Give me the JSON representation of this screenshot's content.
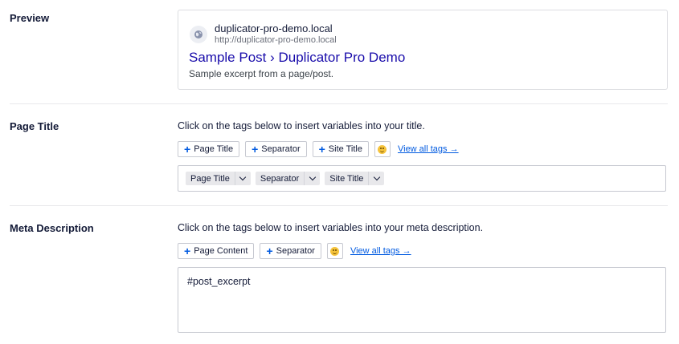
{
  "preview": {
    "label": "Preview",
    "icon": "globe-icon",
    "site_name": "duplicator-pro-demo.local",
    "site_url": "http://duplicator-pro-demo.local",
    "title": "Sample Post › Duplicator Pro Demo",
    "excerpt": "Sample excerpt from a page/post."
  },
  "page_title": {
    "label": "Page Title",
    "instruction": "Click on the tags below to insert variables into your title.",
    "tag_buttons": [
      "Page Title",
      "Separator",
      "Site Title"
    ],
    "view_all": "View all tags →",
    "chips": [
      "Page Title",
      "Separator",
      "Site Title"
    ]
  },
  "meta_description": {
    "label": "Meta Description",
    "instruction": "Click on the tags below to insert variables into your meta description.",
    "tag_buttons": [
      "Page Content",
      "Separator"
    ],
    "view_all": "View all tags →",
    "value": "#post_excerpt"
  },
  "colors": {
    "link_blue": "#005ae0",
    "serp_title": "#1a0dab",
    "chip_bg": "#e8e8eb"
  }
}
